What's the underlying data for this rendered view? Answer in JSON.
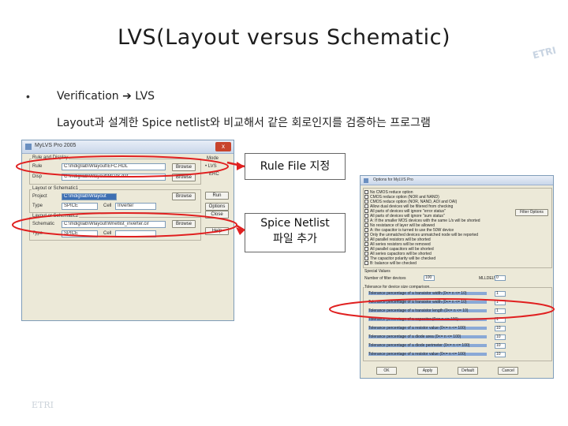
{
  "slide": {
    "title": "LVS(Layout versus Schematic)",
    "corner_text": "ETRI",
    "bullet_char": "•",
    "line1_text": "Verification ",
    "line1_arrow": "➔",
    "line1_after": " LVS",
    "line2_text": "Layout과 설계한 Spice netlist와 비교해서 같은 회로인지를 검증하는 프로그램",
    "callout_rule": "Rule File 지정",
    "callout_spice_line1": "Spice Netlist",
    "callout_spice_line2": "파일 추가",
    "logo_text": "ETRI"
  },
  "win1": {
    "title": "MyLVS Pro 2005",
    "close": "x",
    "group1_label": "Rule and Display",
    "rule_label": "Rule",
    "rule_value": "C:\\mdig\\lab\\Wlayout\\EFC.HDL",
    "disp_label": "Disp",
    "disp_value": "C:\\mdig\\lab\\Wlayout\\MLVS.dat",
    "group2_label": "Layout or Schematic1",
    "project_label": "Project",
    "project_value": "C:\\mdig\\lab\\Wlayout",
    "type_label": "Type",
    "type_value": "SPICE",
    "cell_label": "Cell",
    "cell_value": "Inverter",
    "group3_label": "Layout or Schematic2",
    "schematic_label": "Schematic",
    "schematic_value": "C:\\mdig\\lab\\Wlayout\\Wnetlist_inverter.cir",
    "type2_label": "Type",
    "type2_value": "SPICE",
    "cell2_label": "Cell",
    "cell2_value": "",
    "browse1": "Browse",
    "browse2": "Browse",
    "browse3": "Browse",
    "browse4": "Browse",
    "mode_label": "Mode",
    "lvs_label": "• LVS",
    "erc_label": "ERC",
    "run_label": "Run",
    "options_label": "Options",
    "close_label": "Close",
    "help_label": "Help"
  },
  "win2": {
    "title": "Options for MyLVS Pro",
    "options": [
      "No CMOS reduce option",
      "CMOS reduce option (NOR and NAND)",
      "CMOS reduce option (NOR, NAND, AOI and OAI)",
      "Allow dual devices will be filtered from checking",
      "All parts of devices will ignore \"error status\"",
      "All parts of devices will ignore \"sum status\"",
      "A: If the smaller MOS devices with the same L/s will be shorted",
      "No resistance of layer will be allowed",
      "A: the capacitor is turned to use the 50W device",
      "Only the unmatched devices unmatched node will be reported",
      "All parallel resistors will be shorted",
      "All series resistors will be removed",
      "All parallel capacitors will be shorted",
      "All series capacitors will be shorted",
      "The capacitor polarity will be checked",
      "B: balance will be checked"
    ],
    "filter_button": "Filter Options",
    "special_label": "Special Values",
    "num_devices_label": "Number of filter devices",
    "num_devices_value": "100",
    "mlldelw_label": "MLLDELW",
    "mlldelw_value": "0",
    "tol_group_label": "Tolerance for device size comparison",
    "tolerances": [
      {
        "label": "Tolerance percentage of a transistor width (0<= n <= 10)",
        "value": "1"
      },
      {
        "label": "Tolerance percentage of a transistor width (0<= n <= 10)",
        "value": "1"
      },
      {
        "label": "Tolerance percentage of a transistor length (0<= n <= 10)",
        "value": "1"
      },
      {
        "label": "Tolerance percentage of a capacitor (0<= n <= 100)",
        "value": "1"
      },
      {
        "label": "Tolerance percentage of a resistor value (0<= n <= 100)",
        "value": "10"
      },
      {
        "label": "Tolerance percentage of a diode area (0<= n <= 100)",
        "value": "10"
      },
      {
        "label": "Tolerance percentage of a diode perimeter (0<= n <= 100)",
        "value": "10"
      },
      {
        "label": "Tolerance percentage of a resistor value (0<= n <= 100)",
        "value": "10"
      }
    ],
    "ok": "OK",
    "apply": "Apply",
    "default": "Default",
    "cancel": "Cancel"
  },
  "colors": {
    "annotation_red": "#e02020",
    "highlight_blue": "#3d6fb3"
  }
}
